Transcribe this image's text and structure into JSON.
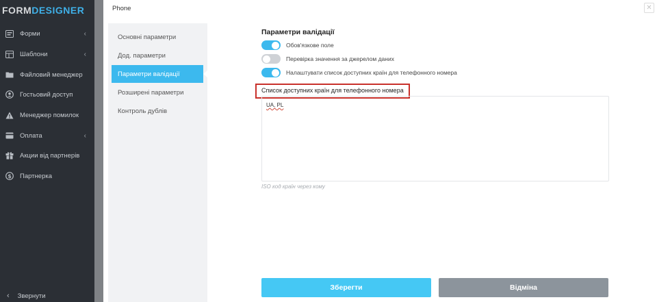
{
  "app": {
    "logo_part1": "FORM",
    "logo_part2": "DESIGNER"
  },
  "sidebar": {
    "items": [
      {
        "label": "Форми",
        "icon": "form-icon",
        "has_submenu": true
      },
      {
        "label": "Шаблони",
        "icon": "template-icon",
        "has_submenu": true
      },
      {
        "label": "Файловий менеджер",
        "icon": "folder-icon",
        "has_submenu": false
      },
      {
        "label": "Гостьовий доступ",
        "icon": "user-circle-icon",
        "has_submenu": false
      },
      {
        "label": "Менеджер помилок",
        "icon": "warning-icon",
        "has_submenu": false
      },
      {
        "label": "Оплата",
        "icon": "card-icon",
        "has_submenu": true
      },
      {
        "label": "Акции від партнерів",
        "icon": "gift-icon",
        "has_submenu": false
      },
      {
        "label": "Партнерка",
        "icon": "dollar-icon",
        "has_submenu": false
      }
    ],
    "collapse_label": "Звернути"
  },
  "modal": {
    "title": "Phone",
    "close_symbol": "✕",
    "nav": [
      {
        "label": "Основні параметри",
        "active": false
      },
      {
        "label": "Дод. параметри",
        "active": false
      },
      {
        "label": "Параметри валідації",
        "active": true
      },
      {
        "label": "Розширені параметри",
        "active": false
      },
      {
        "label": "Контроль дублів",
        "active": false
      }
    ],
    "section_title": "Параметри валідації",
    "toggles": [
      {
        "label": "Обов'язкове поле",
        "on": true
      },
      {
        "label": "Перевірка значення за джерелом даних",
        "on": false
      },
      {
        "label": "Налаштувати список доступних країн для телефонного номера",
        "on": true
      }
    ],
    "countries_field": {
      "label": "Список доступних країн для телефонного номера",
      "value": "UA, PL",
      "hint": "ISO код країн через кому"
    },
    "buttons": {
      "save": "Зберегти",
      "cancel": "Відміна"
    }
  },
  "colors": {
    "sidebar_bg": "#2b2f35",
    "accent": "#3cb9ee",
    "save_button": "#45c8f4",
    "cancel_button": "#8c949c",
    "highlight_box": "#c8302a"
  }
}
